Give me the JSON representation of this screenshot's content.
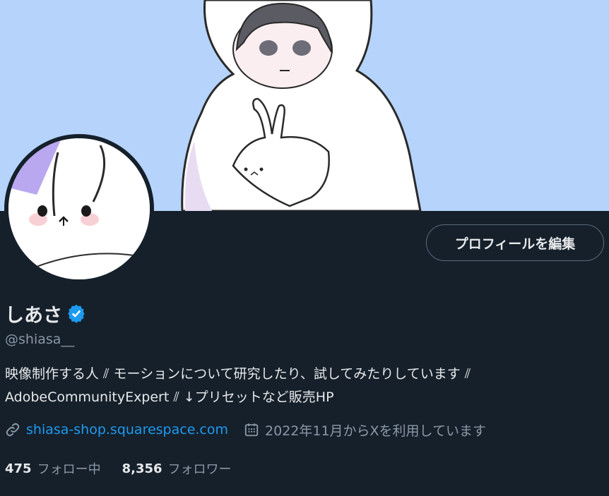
{
  "profile": {
    "display_name": "しあさ",
    "handle": "@shiasa__",
    "bio_line1": "映像制作する人 ⫽ モーションについて研究したり、試してみたりしています ⫽",
    "bio_line2": "AdobeCommunityExpert ⫽ ↓プリセットなど販売HP",
    "verified": true
  },
  "actions": {
    "edit_profile_label": "プロフィールを編集"
  },
  "meta": {
    "website": "shiasa-shop.squarespace.com",
    "joined": "2022年11月からXを利用しています"
  },
  "stats": {
    "following_count": "475",
    "following_label": "フォロー中",
    "followers_count": "8,356",
    "followers_label": "フォロワー"
  },
  "colors": {
    "background": "#15202b",
    "banner": "#b6d3fb",
    "accent": "#1d9bf0",
    "muted_text": "#8b98a5"
  },
  "icons": {
    "verified": "verified-badge-icon",
    "link": "link-icon",
    "calendar": "calendar-icon"
  }
}
